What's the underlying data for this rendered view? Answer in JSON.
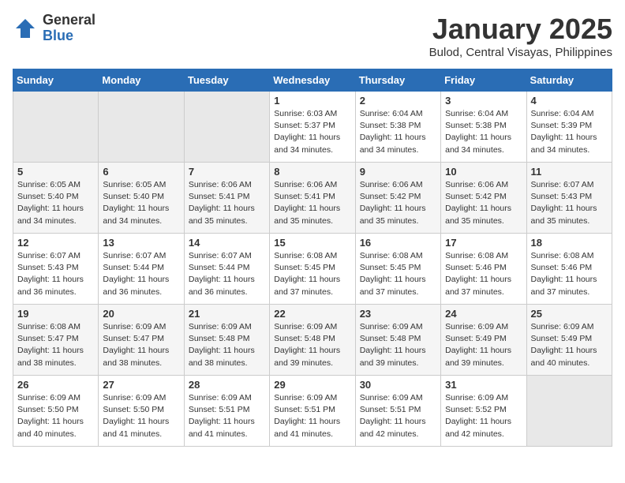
{
  "header": {
    "logo_general": "General",
    "logo_blue": "Blue",
    "month_title": "January 2025",
    "location": "Bulod, Central Visayas, Philippines"
  },
  "days_of_week": [
    "Sunday",
    "Monday",
    "Tuesday",
    "Wednesday",
    "Thursday",
    "Friday",
    "Saturday"
  ],
  "weeks": [
    [
      {
        "day": "",
        "info": ""
      },
      {
        "day": "",
        "info": ""
      },
      {
        "day": "",
        "info": ""
      },
      {
        "day": "1",
        "info": "Sunrise: 6:03 AM\nSunset: 5:37 PM\nDaylight: 11 hours\nand 34 minutes."
      },
      {
        "day": "2",
        "info": "Sunrise: 6:04 AM\nSunset: 5:38 PM\nDaylight: 11 hours\nand 34 minutes."
      },
      {
        "day": "3",
        "info": "Sunrise: 6:04 AM\nSunset: 5:38 PM\nDaylight: 11 hours\nand 34 minutes."
      },
      {
        "day": "4",
        "info": "Sunrise: 6:04 AM\nSunset: 5:39 PM\nDaylight: 11 hours\nand 34 minutes."
      }
    ],
    [
      {
        "day": "5",
        "info": "Sunrise: 6:05 AM\nSunset: 5:40 PM\nDaylight: 11 hours\nand 34 minutes."
      },
      {
        "day": "6",
        "info": "Sunrise: 6:05 AM\nSunset: 5:40 PM\nDaylight: 11 hours\nand 34 minutes."
      },
      {
        "day": "7",
        "info": "Sunrise: 6:06 AM\nSunset: 5:41 PM\nDaylight: 11 hours\nand 35 minutes."
      },
      {
        "day": "8",
        "info": "Sunrise: 6:06 AM\nSunset: 5:41 PM\nDaylight: 11 hours\nand 35 minutes."
      },
      {
        "day": "9",
        "info": "Sunrise: 6:06 AM\nSunset: 5:42 PM\nDaylight: 11 hours\nand 35 minutes."
      },
      {
        "day": "10",
        "info": "Sunrise: 6:06 AM\nSunset: 5:42 PM\nDaylight: 11 hours\nand 35 minutes."
      },
      {
        "day": "11",
        "info": "Sunrise: 6:07 AM\nSunset: 5:43 PM\nDaylight: 11 hours\nand 35 minutes."
      }
    ],
    [
      {
        "day": "12",
        "info": "Sunrise: 6:07 AM\nSunset: 5:43 PM\nDaylight: 11 hours\nand 36 minutes."
      },
      {
        "day": "13",
        "info": "Sunrise: 6:07 AM\nSunset: 5:44 PM\nDaylight: 11 hours\nand 36 minutes."
      },
      {
        "day": "14",
        "info": "Sunrise: 6:07 AM\nSunset: 5:44 PM\nDaylight: 11 hours\nand 36 minutes."
      },
      {
        "day": "15",
        "info": "Sunrise: 6:08 AM\nSunset: 5:45 PM\nDaylight: 11 hours\nand 37 minutes."
      },
      {
        "day": "16",
        "info": "Sunrise: 6:08 AM\nSunset: 5:45 PM\nDaylight: 11 hours\nand 37 minutes."
      },
      {
        "day": "17",
        "info": "Sunrise: 6:08 AM\nSunset: 5:46 PM\nDaylight: 11 hours\nand 37 minutes."
      },
      {
        "day": "18",
        "info": "Sunrise: 6:08 AM\nSunset: 5:46 PM\nDaylight: 11 hours\nand 37 minutes."
      }
    ],
    [
      {
        "day": "19",
        "info": "Sunrise: 6:08 AM\nSunset: 5:47 PM\nDaylight: 11 hours\nand 38 minutes."
      },
      {
        "day": "20",
        "info": "Sunrise: 6:09 AM\nSunset: 5:47 PM\nDaylight: 11 hours\nand 38 minutes."
      },
      {
        "day": "21",
        "info": "Sunrise: 6:09 AM\nSunset: 5:48 PM\nDaylight: 11 hours\nand 38 minutes."
      },
      {
        "day": "22",
        "info": "Sunrise: 6:09 AM\nSunset: 5:48 PM\nDaylight: 11 hours\nand 39 minutes."
      },
      {
        "day": "23",
        "info": "Sunrise: 6:09 AM\nSunset: 5:48 PM\nDaylight: 11 hours\nand 39 minutes."
      },
      {
        "day": "24",
        "info": "Sunrise: 6:09 AM\nSunset: 5:49 PM\nDaylight: 11 hours\nand 39 minutes."
      },
      {
        "day": "25",
        "info": "Sunrise: 6:09 AM\nSunset: 5:49 PM\nDaylight: 11 hours\nand 40 minutes."
      }
    ],
    [
      {
        "day": "26",
        "info": "Sunrise: 6:09 AM\nSunset: 5:50 PM\nDaylight: 11 hours\nand 40 minutes."
      },
      {
        "day": "27",
        "info": "Sunrise: 6:09 AM\nSunset: 5:50 PM\nDaylight: 11 hours\nand 41 minutes."
      },
      {
        "day": "28",
        "info": "Sunrise: 6:09 AM\nSunset: 5:51 PM\nDaylight: 11 hours\nand 41 minutes."
      },
      {
        "day": "29",
        "info": "Sunrise: 6:09 AM\nSunset: 5:51 PM\nDaylight: 11 hours\nand 41 minutes."
      },
      {
        "day": "30",
        "info": "Sunrise: 6:09 AM\nSunset: 5:51 PM\nDaylight: 11 hours\nand 42 minutes."
      },
      {
        "day": "31",
        "info": "Sunrise: 6:09 AM\nSunset: 5:52 PM\nDaylight: 11 hours\nand 42 minutes."
      },
      {
        "day": "",
        "info": ""
      }
    ]
  ]
}
